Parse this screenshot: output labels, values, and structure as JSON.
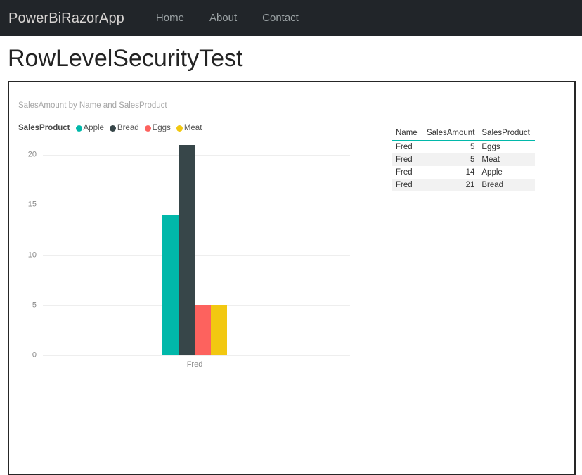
{
  "navbar": {
    "brand": "PowerBiRazorApp",
    "links": [
      {
        "label": "Home"
      },
      {
        "label": "About"
      },
      {
        "label": "Contact"
      }
    ],
    "background_color": "#212529"
  },
  "page": {
    "title": "RowLevelSecurityTest"
  },
  "report": {
    "border_color": "#262626"
  },
  "chart_data": {
    "type": "bar",
    "title": "SalesAmount by Name and SalesProduct",
    "legend_title": "SalesProduct",
    "legend_position": "top",
    "xlabel": "",
    "ylabel": "",
    "categories": [
      "Fred"
    ],
    "ylim": [
      0,
      20
    ],
    "yticks": [
      0,
      5,
      10,
      15,
      20
    ],
    "ytick_labels": [
      "0",
      "5",
      "10",
      "15",
      "20"
    ],
    "grid": true,
    "series": [
      {
        "name": "Apple",
        "color": "#01b8aa",
        "values": [
          14
        ]
      },
      {
        "name": "Bread",
        "color": "#374649",
        "values": [
          21
        ]
      },
      {
        "name": "Eggs",
        "color": "#fd625e",
        "values": [
          5
        ]
      },
      {
        "name": "Meat",
        "color": "#f2c811",
        "values": [
          5
        ]
      }
    ]
  },
  "table": {
    "columns": [
      "Name",
      "SalesAmount",
      "SalesProduct"
    ],
    "rows": [
      {
        "name": "Fred",
        "amount": "5",
        "product": "Eggs"
      },
      {
        "name": "Fred",
        "amount": "5",
        "product": "Meat"
      },
      {
        "name": "Fred",
        "amount": "14",
        "product": "Apple"
      },
      {
        "name": "Fred",
        "amount": "21",
        "product": "Bread"
      }
    ],
    "header_rule_color": "#01b8aa",
    "stripe_color": "#f2f2f2"
  }
}
